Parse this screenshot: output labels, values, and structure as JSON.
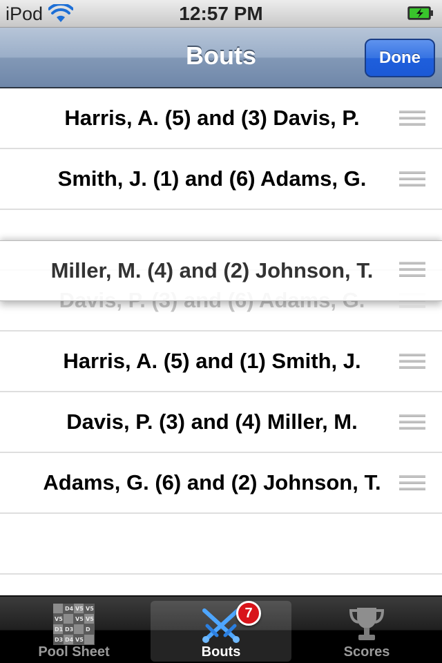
{
  "status_bar": {
    "carrier": "iPod",
    "time": "12:57 PM"
  },
  "nav": {
    "title": "Bouts",
    "done_label": "Done"
  },
  "rows": [
    "Harris, A. (5) and (3) Davis, P.",
    "Smith, J. (1) and (6) Adams, G.",
    "Davis, P. (3) and (6) Adams, G.",
    "Harris, A. (5) and (1) Smith, J.",
    "Davis, P. (3) and (4) Miller, M.",
    "Adams, G. (6) and (2) Johnson, T."
  ],
  "dragged_row": "Miller, M. (4) and (2) Johnson, T.",
  "tabs": [
    {
      "label": "Pool Sheet",
      "icon": "pool-sheet-grid-icon",
      "selected": false
    },
    {
      "label": "Bouts",
      "icon": "crossed-swords-icon",
      "selected": true,
      "badge": "7"
    },
    {
      "label": "Scores",
      "icon": "trophy-icon",
      "selected": false
    }
  ],
  "pool_sheet_icon_cells": [
    "D4",
    "V5",
    "V5",
    "V5",
    "V5",
    "V5",
    "D1",
    "D3",
    "D",
    "D3",
    "D4",
    "V5"
  ],
  "colors": {
    "nav_bar": "#8298b6",
    "done_button": "#1f5fdc",
    "badge": "#d8141a",
    "tab_bar": "#000000"
  }
}
